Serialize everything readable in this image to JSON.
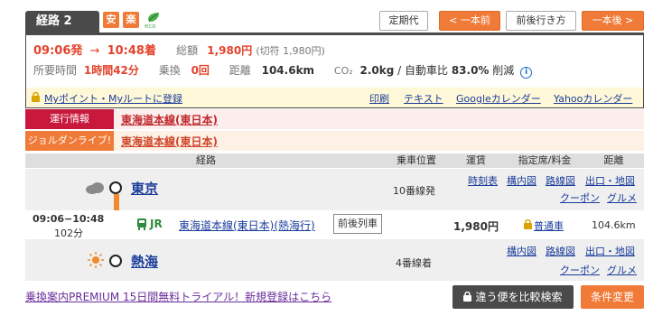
{
  "route": {
    "tab_label": "経路 2",
    "badge_safe": "安",
    "badge_easy": "楽",
    "eco": "eco"
  },
  "toolbar": {
    "teikidai": "定期代",
    "prev": "< 一本前",
    "before_after": "前後行き方",
    "next": "一本後 >"
  },
  "summary": {
    "dep_time": "09:06発",
    "arrow": "→",
    "arr_time": "10:48着",
    "total_label": "総額",
    "total_value": "1,980円",
    "total_note": "(切符 1,980円)",
    "duration_label": "所要時間",
    "duration_value": "1時間42分",
    "transfer_label": "乗換",
    "transfer_value": "0回",
    "distance_label": "距離",
    "distance_value": "104.6km",
    "co2_label": "CO₂",
    "co2_value": "2.0kg",
    "co2_note": "/ 自動車比",
    "co2_pct": "83.0%",
    "co2_suffix": "削減",
    "mypoint_link": "Myポイント・Myルートに登録",
    "links": [
      "印刷",
      "テキスト",
      "Googleカレンダー",
      "Yahooカレンダー"
    ]
  },
  "info": {
    "unkou_label": "運行情報",
    "unkou_link": "東海道本線(東日本)",
    "jorudan_label": "ジョルダンライブ!",
    "jorudan_link": "東海道本線(東日本)"
  },
  "table": {
    "headers": [
      "経路",
      "乗車位置",
      "運賃",
      "指定席/料金",
      "距離"
    ],
    "from": {
      "name": "東京",
      "platform": "10番線発",
      "links": [
        "時刻表",
        "構内図",
        "路線図",
        "出口・地図",
        "クーポン",
        "グルメ"
      ]
    },
    "leg": {
      "time": "09:06−10:48",
      "minutes": "102分",
      "company": "JR",
      "line": "東海道本線(東日本)(熱海行)",
      "zengo": "前後列車",
      "fare": "1,980円",
      "seat": "普通車",
      "distance": "104.6km"
    },
    "to": {
      "name": "熱海",
      "platform": "4番線着",
      "links": [
        "構内図",
        "路線図",
        "出口・地図",
        "クーポン",
        "グルメ"
      ]
    }
  },
  "footer": {
    "premium_link": "乗換案内PREMIUM 15日間無料トライアル！新規登録はこちら",
    "compare": "違う便を比較検索",
    "conditions": "条件変更"
  },
  "colors": {
    "accent": "#f07a37",
    "dark": "#4a4a4a",
    "route_line": "#f08a2c",
    "unkou": "#c8183c",
    "jorudan": "#f07a37"
  }
}
